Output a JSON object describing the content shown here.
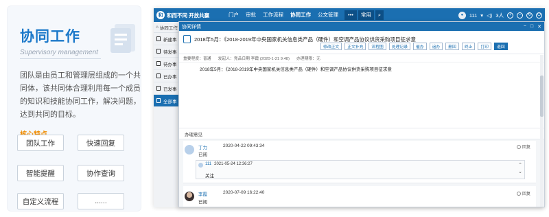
{
  "card": {
    "title": "协同工作",
    "subtitle": "Supervisory management",
    "description": "团队是由员工和管理层组成的一个共同体，该共同体合理利用每一个成员的知识和技能协同工作，解决问题，达到共同的目标。",
    "core_label": "核心特点",
    "features": [
      "团队工作",
      "快速回复",
      "智能提醒",
      "协作查询",
      "自定义流程",
      "......"
    ]
  },
  "app": {
    "brand": "和而不同 开放共赢",
    "logo_char": "和",
    "nav": [
      "门户",
      "审批",
      "工作流程",
      "协同工作",
      "公文管理"
    ],
    "nav_active": "协同工作",
    "more": "•••",
    "common": "常用",
    "user": "111",
    "user_count": "3人",
    "sidebar_title": "协同工作",
    "sidebar_items": [
      "新建事",
      "待发事",
      "待办事",
      "已办事",
      "已发事",
      "全部事"
    ],
    "sidebar_active_index": 5
  },
  "dialog": {
    "title": "协同详情",
    "subject": "2018年5月：《2018-2019年中央国家机关信息类产品（硬件）和空调产品协议供货采购项目征求意",
    "actions": [
      "修改正文",
      "正文补充",
      "流程图",
      "处理记录",
      "催办",
      "追办",
      "删回",
      "终止",
      "打印",
      "退回"
    ],
    "meta": {
      "urgency": "重要程度：普通",
      "sender": "发起人：竞品日期 李霞 (2020-1-21 9:48)",
      "deadline": "办理期限：无"
    },
    "body": "2018年5月：《2018-2019年中央国家机关信息类产品（硬件）和空调产品协议供货采购项目征求意",
    "process_label": "办理意见",
    "opinions": [
      {
        "name": "丁力",
        "status": "已阅",
        "time": "2020-04-22 09:43:34",
        "reply_label": "回复",
        "sub_reply": {
          "user": "111",
          "time": "2021-05-24 12:36:27",
          "text": "关注"
        }
      },
      {
        "name": "李霞",
        "status": "已阅",
        "time": "2020-07-09 16:22:40",
        "reply_label": "回复"
      }
    ]
  }
}
